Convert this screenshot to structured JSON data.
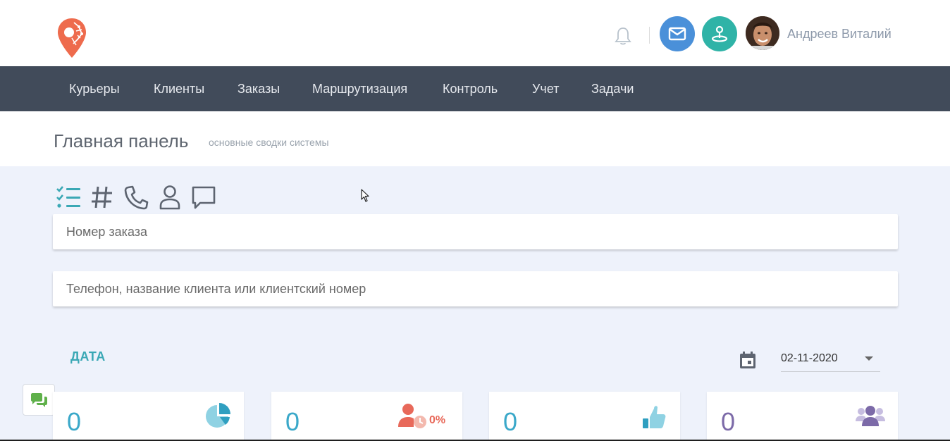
{
  "header": {
    "user_name": "Андреев Виталий",
    "icons": [
      "logo-pin-icon",
      "bell-icon",
      "mail-icon",
      "map-marker-icon",
      "avatar"
    ],
    "colors": {
      "mail": "#4a90d9",
      "map": "#2fb3a7",
      "logo": "#ee6b4d"
    }
  },
  "nav": {
    "items": [
      {
        "label": "Курьеры"
      },
      {
        "label": "Клиенты"
      },
      {
        "label": "Заказы"
      },
      {
        "label": "Маршрутизация"
      },
      {
        "label": "Контроль"
      },
      {
        "label": "Учет"
      },
      {
        "label": "Задачи"
      }
    ],
    "background": "#414b5a"
  },
  "page": {
    "title": "Главная панель",
    "subtitle": "основные сводки системы"
  },
  "search": {
    "mode_icons": [
      "checklist-icon",
      "hash-icon",
      "phone-icon",
      "user-icon",
      "comment-icon"
    ],
    "order_placeholder": "Номер заказа",
    "client_placeholder": "Телефон, название клиента или клиентский номер"
  },
  "date": {
    "label": "ДАТА",
    "value": "02-11-2020"
  },
  "stats": [
    {
      "value": "0",
      "icon": "pie-chart-icon",
      "color": "#3aa8c9"
    },
    {
      "value": "0",
      "icon": "user-clock-icon",
      "badge": "0%",
      "color": "#3aa8c9",
      "icon_color": "#e8695a"
    },
    {
      "value": "0",
      "icon": "thumbs-up-icon",
      "color": "#3aa8c9"
    },
    {
      "value": "0",
      "icon": "users-icon",
      "color": "#7c6aa8"
    }
  ]
}
